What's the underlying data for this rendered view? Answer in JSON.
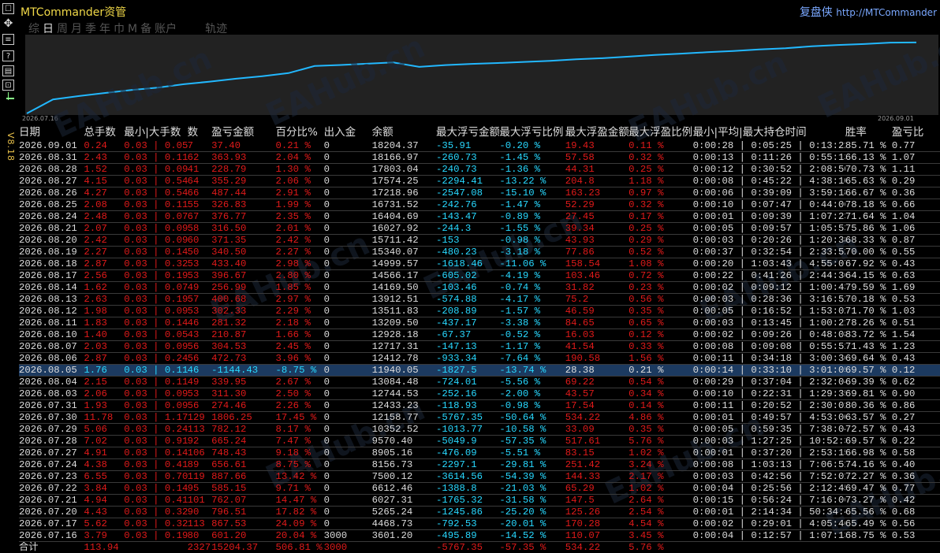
{
  "window": {
    "title": "MTCommander资管",
    "brand": "复盘侠",
    "brand_url": "http://MTCommander",
    "version": "V8.18"
  },
  "left_icons": [
    "move-icon",
    "settings-icon",
    "refresh-icon",
    "help-icon",
    "history-icon",
    "layout-icon"
  ],
  "tabs": [
    {
      "label": "综",
      "active": false
    },
    {
      "label": "日",
      "active": true
    },
    {
      "label": "周",
      "active": false
    },
    {
      "label": "月",
      "active": false
    },
    {
      "label": "季",
      "active": false
    },
    {
      "label": "年",
      "active": false
    },
    {
      "label": "巾",
      "active": false
    },
    {
      "label": "M",
      "active": false
    },
    {
      "label": "备",
      "active": false
    },
    {
      "label": "账户",
      "active": false
    }
  ],
  "path_tab": "轨迹",
  "watermark": "EAHub.cn",
  "chart_data": {
    "type": "line",
    "x_start_label": "2026.07.16",
    "x_end_label": "2026.09.01",
    "line_color": "#22b8ff",
    "background": "#222222"
  },
  "columns": [
    "日期",
    "总手数",
    "最小|大手数",
    "数",
    "盈亏金额",
    "百分比%",
    "出入金",
    "余额",
    "最大浮亏金额",
    "最大浮亏比例",
    "最大浮盈金额",
    "最大浮盈比例",
    "最小|平均|最大持仓时间",
    "胜率",
    "盈亏比"
  ],
  "rows": [
    [
      "2026.09.01",
      "0.24",
      "0.03 | 0.05",
      "7",
      "37.40",
      "0.21 %",
      "0",
      "18204.37",
      "-35.91",
      "-0.20 %",
      "19.43",
      "0.11 %",
      "0:00:28 | 0:05:25 | 0:13:22",
      "85.71 %",
      "0.77"
    ],
    [
      "2026.08.31",
      "2.43",
      "0.03 | 0.11",
      "62",
      "363.93",
      "2.04 %",
      "0",
      "18166.97",
      "-260.73",
      "-1.45 %",
      "57.58",
      "0.32 %",
      "0:00:13 | 0:11:26 | 0:55:13",
      "66.13 %",
      "1.07"
    ],
    [
      "2026.08.28",
      "1.52",
      "0.03 | 0.09",
      "41",
      "228.79",
      "1.30 %",
      "0",
      "17803.04",
      "-240.73",
      "-1.36 %",
      "44.31",
      "0.25 %",
      "0:00:12 | 0:30:52 | 2:08:50",
      "70.73 %",
      "1.11"
    ],
    [
      "2026.08.27",
      "4.15",
      "0.03 | 0.54",
      "64",
      "355.29",
      "2.06 %",
      "0",
      "17574.25",
      "-2294.41",
      "-13.22 %",
      "204.8",
      "1.18 %",
      "0:00:08 | 0:45:22 | 4:38:10",
      "65.63 %",
      "0.29"
    ],
    [
      "2026.08.26",
      "4.27",
      "0.03 | 0.54",
      "66",
      "487.44",
      "2.91 %",
      "0",
      "17218.96",
      "-2547.08",
      "-15.10 %",
      "163.23",
      "0.97 %",
      "0:00:06 | 0:39:09 | 3:59:18",
      "66.67 %",
      "0.36"
    ],
    [
      "2026.08.25",
      "2.08",
      "0.03 | 0.11",
      "55",
      "326.83",
      "1.99 %",
      "0",
      "16731.52",
      "-242.76",
      "-1.47 %",
      "52.29",
      "0.32 %",
      "0:00:10 | 0:07:47 | 0:44:06",
      "78.18 %",
      "0.66"
    ],
    [
      "2026.08.24",
      "2.48",
      "0.03 | 0.07",
      "67",
      "376.77",
      "2.35 %",
      "0",
      "16404.69",
      "-143.47",
      "-0.89 %",
      "27.45",
      "0.17 %",
      "0:00:01 | 0:09:39 | 1:07:23",
      "71.64 %",
      "1.04"
    ],
    [
      "2026.08.21",
      "2.07",
      "0.03 | 0.09",
      "58",
      "316.50",
      "2.01 %",
      "0",
      "16027.92",
      "-244.3",
      "-1.55 %",
      "39.34",
      "0.25 %",
      "0:00:05 | 0:09:57 | 1:05:53",
      "75.86 %",
      "1.06"
    ],
    [
      "2026.08.20",
      "2.42",
      "0.03 | 0.09",
      "60",
      "371.35",
      "2.42 %",
      "0",
      "15711.42",
      "-153",
      "-0.98 %",
      "43.93",
      "0.29 %",
      "0:00:03 | 0:20:26 | 1:20:38",
      "68.33 %",
      "0.87"
    ],
    [
      "2026.08.19",
      "2.27",
      "0.03 | 0.14",
      "50",
      "340.50",
      "2.27 %",
      "0",
      "15340.07",
      "-480.23",
      "-3.18 %",
      "77.86",
      "0.52 %",
      "0:00:37 | 0:32:54 | 2:33:52",
      "70.00 %",
      "0.55"
    ],
    [
      "2026.08.18",
      "2.87",
      "0.03 | 0.32",
      "53",
      "433.40",
      "2.98 %",
      "0",
      "14999.57",
      "-1618.46",
      "-11.06 %",
      "158.54",
      "1.08 %",
      "0:00:20 | 1:03:43 | 4:55:07",
      "67.92 %",
      "0.43"
    ],
    [
      "2026.08.17",
      "2.56",
      "0.03 | 0.19",
      "53",
      "396.67",
      "2.80 %",
      "0",
      "14566.17",
      "-605.02",
      "-4.19 %",
      "103.46",
      "0.72 %",
      "0:00:22 | 0:41:26 | 2:44:36",
      "64.15 %",
      "0.63"
    ],
    [
      "2026.08.14",
      "1.62",
      "0.03 | 0.07",
      "49",
      "256.99",
      "1.85 %",
      "0",
      "14169.50",
      "-103.46",
      "-0.74 %",
      "31.82",
      "0.23 %",
      "0:00:02 | 0:09:12 | 1:00:43",
      "79.59 %",
      "1.69"
    ],
    [
      "2026.08.13",
      "2.63",
      "0.03 | 0.19",
      "57",
      "400.68",
      "2.97 %",
      "0",
      "13912.51",
      "-574.88",
      "-4.17 %",
      "75.2",
      "0.56 %",
      "0:00:03 | 0:28:36 | 3:16:52",
      "70.18 %",
      "0.53"
    ],
    [
      "2026.08.12",
      "1.98",
      "0.03 | 0.09",
      "53",
      "302.33",
      "2.29 %",
      "0",
      "13511.83",
      "-208.89",
      "-1.57 %",
      "46.59",
      "0.35 %",
      "0:00:05 | 0:16:52 | 1:53:02",
      "71.70 %",
      "1.03"
    ],
    [
      "2026.08.11",
      "1.83",
      "0.03 | 0.14",
      "46",
      "281.32",
      "2.18 %",
      "0",
      "13209.50",
      "-437.17",
      "-3.38 %",
      "84.65",
      "0.65 %",
      "0:00:03 | 0:13:45 | 1:00:21",
      "78.26 %",
      "0.51"
    ],
    [
      "2026.08.10",
      "1.40",
      "0.03 | 0.05",
      "43",
      "210.87",
      "1.66 %",
      "0",
      "12928.18",
      "-67.37",
      "-0.52 %",
      "16.03",
      "0.12 %",
      "0:00:02 | 0:09:26 | 0:48:08",
      "83.72 %",
      "1.54"
    ],
    [
      "2026.08.07",
      "2.03",
      "0.03 | 0.09",
      "56",
      "304.53",
      "2.45 %",
      "0",
      "12717.31",
      "-147.13",
      "-1.17 %",
      "41.54",
      "0.33 %",
      "0:00:08 | 0:09:08 | 0:55:51",
      "71.43 %",
      "1.23"
    ],
    [
      "2026.08.06",
      "2.87",
      "0.03 | 0.24",
      "56",
      "472.73",
      "3.96 %",
      "0",
      "12412.78",
      "-933.34",
      "-7.64 %",
      "190.58",
      "1.56 %",
      "0:00:11 | 0:34:18 | 3:00:36",
      "69.64 %",
      "0.43"
    ],
    [
      "2026.08.05",
      "1.76",
      "0.03 | 0.11",
      "46",
      "-1144.43",
      "-8.75 %",
      "0",
      "11940.05",
      "-1827.5",
      "-13.74 %",
      "28.38",
      "0.21 %",
      "0:00:14 | 0:33:10 | 3:01:05",
      "69.57 %",
      "0.12"
    ],
    [
      "2026.08.04",
      "2.15",
      "0.03 | 0.11",
      "49",
      "339.95",
      "2.67 %",
      "0",
      "13084.48",
      "-724.01",
      "-5.56 %",
      "69.22",
      "0.54 %",
      "0:00:29 | 0:37:04 | 2:32:04",
      "69.39 %",
      "0.62"
    ],
    [
      "2026.08.03",
      "2.06",
      "0.03 | 0.09",
      "53",
      "311.30",
      "2.50 %",
      "0",
      "12744.53",
      "-252.16",
      "-2.00 %",
      "43.57",
      "0.34 %",
      "0:00:10 | 0:22:31 | 1:29:35",
      "69.81 %",
      "0.90"
    ],
    [
      "2026.07.31",
      "1.93",
      "0.03 | 0.09",
      "56",
      "274.46",
      "2.26 %",
      "0",
      "12433.23",
      "-118.93",
      "-0.98 %",
      "17.54",
      "0.14 %",
      "0:00:11 | 0:20:52 | 2:30:01",
      "80.36 %",
      "0.86"
    ],
    [
      "2026.07.30",
      "11.78",
      "0.03 | 1.17",
      "129",
      "1806.25",
      "17.45 %",
      "0",
      "12158.77",
      "-5767.35",
      "-50.64 %",
      "534.22",
      "4.86 %",
      "0:00:01 | 0:49:57 | 4:53:00",
      "63.57 %",
      "0.27"
    ],
    [
      "2026.07.29",
      "5.06",
      "0.03 | 0.24",
      "113",
      "782.12",
      "8.17 %",
      "0",
      "10352.52",
      "-1013.77",
      "-10.58 %",
      "33.09",
      "0.35 %",
      "0:00:05 | 0:59:35 | 7:38:04",
      "72.57 %",
      "0.43"
    ],
    [
      "2026.07.28",
      "7.02",
      "0.03 | 0.91",
      "92",
      "665.24",
      "7.47 %",
      "0",
      "9570.40",
      "-5049.9",
      "-57.35 %",
      "517.61",
      "5.76 %",
      "0:00:03 | 1:27:25 | 10:52:33",
      "69.57 %",
      "0.22"
    ],
    [
      "2026.07.27",
      "4.91",
      "0.03 | 0.14",
      "106",
      "748.43",
      "9.18 %",
      "0",
      "8905.16",
      "-476.09",
      "-5.51 %",
      "83.15",
      "1.02 %",
      "0:00:01 | 0:37:20 | 2:53:15",
      "66.98 %",
      "0.58"
    ],
    [
      "2026.07.24",
      "4.38",
      "0.03 | 0.41",
      "89",
      "656.61",
      "8.75 %",
      "0",
      "8156.73",
      "-2297.1",
      "-29.81 %",
      "251.42",
      "3.24 %",
      "0:00:08 | 1:03:13 | 7:06:51",
      "74.16 %",
      "0.40"
    ],
    [
      "2026.07.23",
      "6.55",
      "0.03 | 0.70",
      "119",
      "887.66",
      "13.42 %",
      "0",
      "7500.12",
      "-3614.56",
      "-54.39 %",
      "144.33",
      "2.17 %",
      "0:00:03 | 0:42:56 | 7:52:01",
      "72.27 %",
      "0.36"
    ],
    [
      "2026.07.22",
      "3.84",
      "0.03 | 0.14",
      "95",
      "585.15",
      "9.71 %",
      "0",
      "6612.46",
      "-1388.8",
      "-21.03 %",
      "65.29",
      "1.02 %",
      "0:00:04 | 0:25:56 | 2:12:45",
      "69.47 %",
      "0.77"
    ],
    [
      "2026.07.21",
      "4.94",
      "0.03 | 0.41",
      "101",
      "762.07",
      "14.47 %",
      "0",
      "6027.31",
      "-1765.32",
      "-31.58 %",
      "147.5",
      "2.64 %",
      "0:00:15 | 0:56:24 | 7:16:06",
      "73.27 %",
      "0.42"
    ],
    [
      "2026.07.20",
      "4.43",
      "0.03 | 0.32",
      "90",
      "796.51",
      "17.82 %",
      "0",
      "5265.24",
      "-1245.86",
      "-25.20 %",
      "125.26",
      "2.54 %",
      "0:00:01 | 2:14:34 | 50:34:47",
      "65.56 %",
      "0.68"
    ],
    [
      "2026.07.17",
      "5.62",
      "0.03 | 0.32",
      "113",
      "867.53",
      "24.09 %",
      "0",
      "4468.73",
      "-792.53",
      "-20.01 %",
      "170.28",
      "4.54 %",
      "0:00:02 | 0:29:01 | 4:05:46",
      "65.49 %",
      "0.56"
    ],
    [
      "2026.07.16",
      "3.79",
      "0.03 | 0.19",
      "80",
      "601.20",
      "20.04 %",
      "3000",
      "3601.20",
      "-495.89",
      "-14.52 %",
      "110.07",
      "3.45 %",
      "0:00:04 | 0:12:57 | 1:07:13",
      "68.75 %",
      "0.53"
    ]
  ],
  "totals": [
    "合计",
    "113.94",
    "",
    "2327",
    "15204.37",
    "506.81 %",
    "3000",
    "",
    "-5767.35",
    "-57.35 %",
    "534.22",
    "5.76 %",
    "",
    "",
    ""
  ]
}
